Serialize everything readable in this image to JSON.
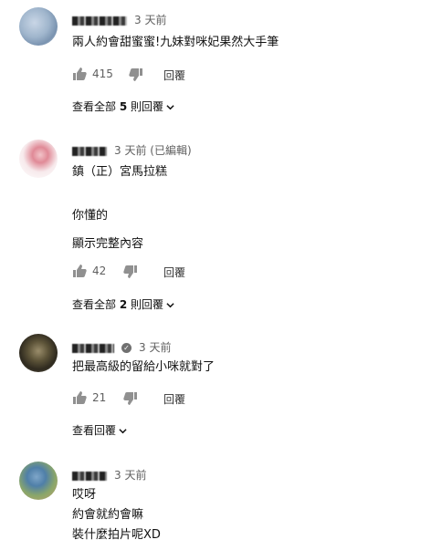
{
  "comments": [
    {
      "time": "3 天前",
      "lines": [
        "兩人約會甜蜜蜜!九妹對咪妃果然大手筆"
      ],
      "likes": "415",
      "reply_label": "回覆",
      "replies_toggle": {
        "pre": "查看全部 ",
        "count": "5",
        "post": " 則回覆"
      }
    },
    {
      "time": "3 天前 (已編輯)",
      "lines": [
        "鎮（正）宮馬拉糕",
        "",
        "你懂的"
      ],
      "read_more": "顯示完整內容",
      "likes": "42",
      "reply_label": "回覆",
      "replies_toggle": {
        "pre": "查看全部 ",
        "count": "2",
        "post": " 則回覆"
      }
    },
    {
      "time": "3 天前",
      "lines": [
        "把最高級的留給小咪就對了"
      ],
      "likes": "21",
      "reply_label": "回覆",
      "replies_toggle": {
        "pre": "查看回覆",
        "count": "",
        "post": ""
      }
    },
    {
      "time": "3 天前",
      "lines": [
        "哎呀",
        "約會就約會嘛",
        "裝什麼拍片呢XD"
      ]
    }
  ],
  "icons": {
    "like": "thumbs-up-icon",
    "dislike": "thumbs-down-icon",
    "chevron": "chevron-down-icon",
    "verified": "verified-check-icon"
  },
  "colors": {
    "text": "#111111",
    "meta": "#606060",
    "background": "#ffffff"
  }
}
